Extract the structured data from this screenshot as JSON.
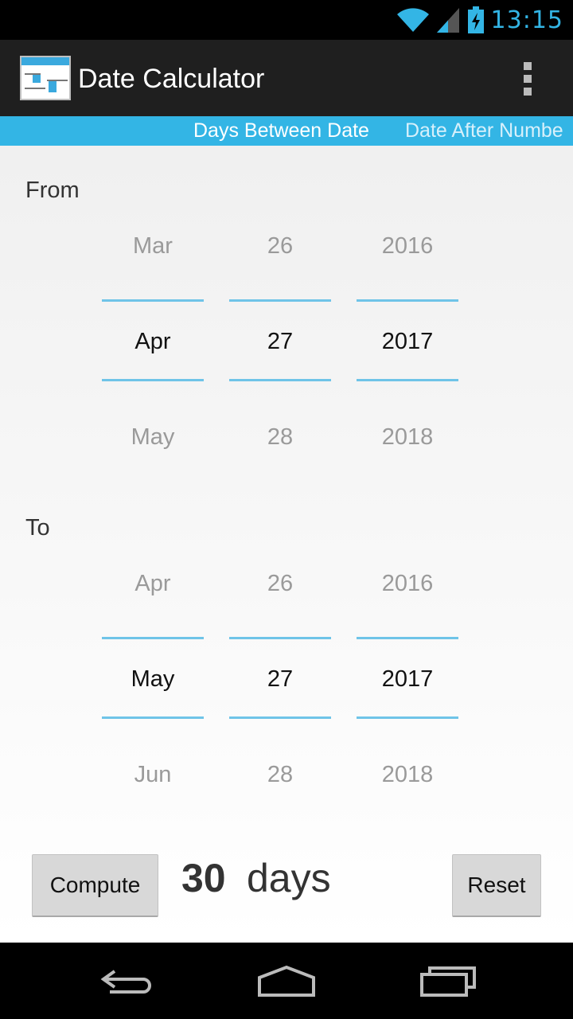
{
  "status_bar": {
    "time": "13:15",
    "icons": [
      "wifi-icon",
      "signal-icon",
      "battery-charging-icon"
    ]
  },
  "action_bar": {
    "title": "Date Calculator",
    "app_icon": "calendar-calculator-icon",
    "overflow_icon": "overflow-menu-icon"
  },
  "tabs": [
    {
      "label": "Days Between Date",
      "active": true
    },
    {
      "label": "Date After Numbe",
      "active": false
    }
  ],
  "from": {
    "label": "From",
    "month": {
      "prev": "Mar",
      "current": "Apr",
      "next": "May"
    },
    "day": {
      "prev": "26",
      "current": "27",
      "next": "28"
    },
    "year": {
      "prev": "2016",
      "current": "2017",
      "next": "2018"
    }
  },
  "to": {
    "label": "To",
    "month": {
      "prev": "Apr",
      "current": "May",
      "next": "Jun"
    },
    "day": {
      "prev": "26",
      "current": "27",
      "next": "28"
    },
    "year": {
      "prev": "2016",
      "current": "2017",
      "next": "2018"
    }
  },
  "actions": {
    "compute_label": "Compute",
    "reset_label": "Reset"
  },
  "result": {
    "value": "30",
    "unit": "days"
  },
  "nav_bar": {
    "icons": [
      "back-icon",
      "home-icon",
      "recent-apps-icon"
    ]
  },
  "colors": {
    "accent": "#33b5e5",
    "divider": "#6fc4e8",
    "actionbar": "#1f1f1f"
  }
}
